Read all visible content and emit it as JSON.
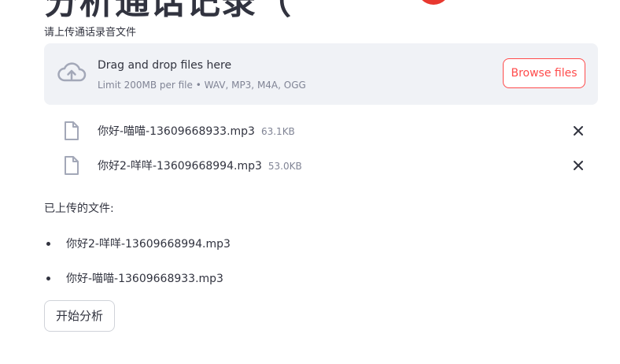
{
  "page": {
    "title": "分析通话记录（"
  },
  "uploader": {
    "label": "请上传通话录音文件",
    "drop_text": "Drag and drop files here",
    "limit_text": "Limit 200MB per file • WAV, MP3, M4A, OGG",
    "browse_label": "Browse files",
    "icon": "cloud-upload-icon",
    "accent_color": "#ff4b4b",
    "files": [
      {
        "name": "你好-喵喵-13609668933.mp3",
        "size": "63.1KB"
      },
      {
        "name": "你好2-咩咩-13609668994.mp3",
        "size": "53.0KB"
      }
    ]
  },
  "uploaded": {
    "heading": "已上传的文件:",
    "items": [
      "你好2-咩咩-13609668994.mp3",
      "你好-喵喵-13609668933.mp3"
    ]
  },
  "actions": {
    "analyze_label": "开始分析"
  }
}
